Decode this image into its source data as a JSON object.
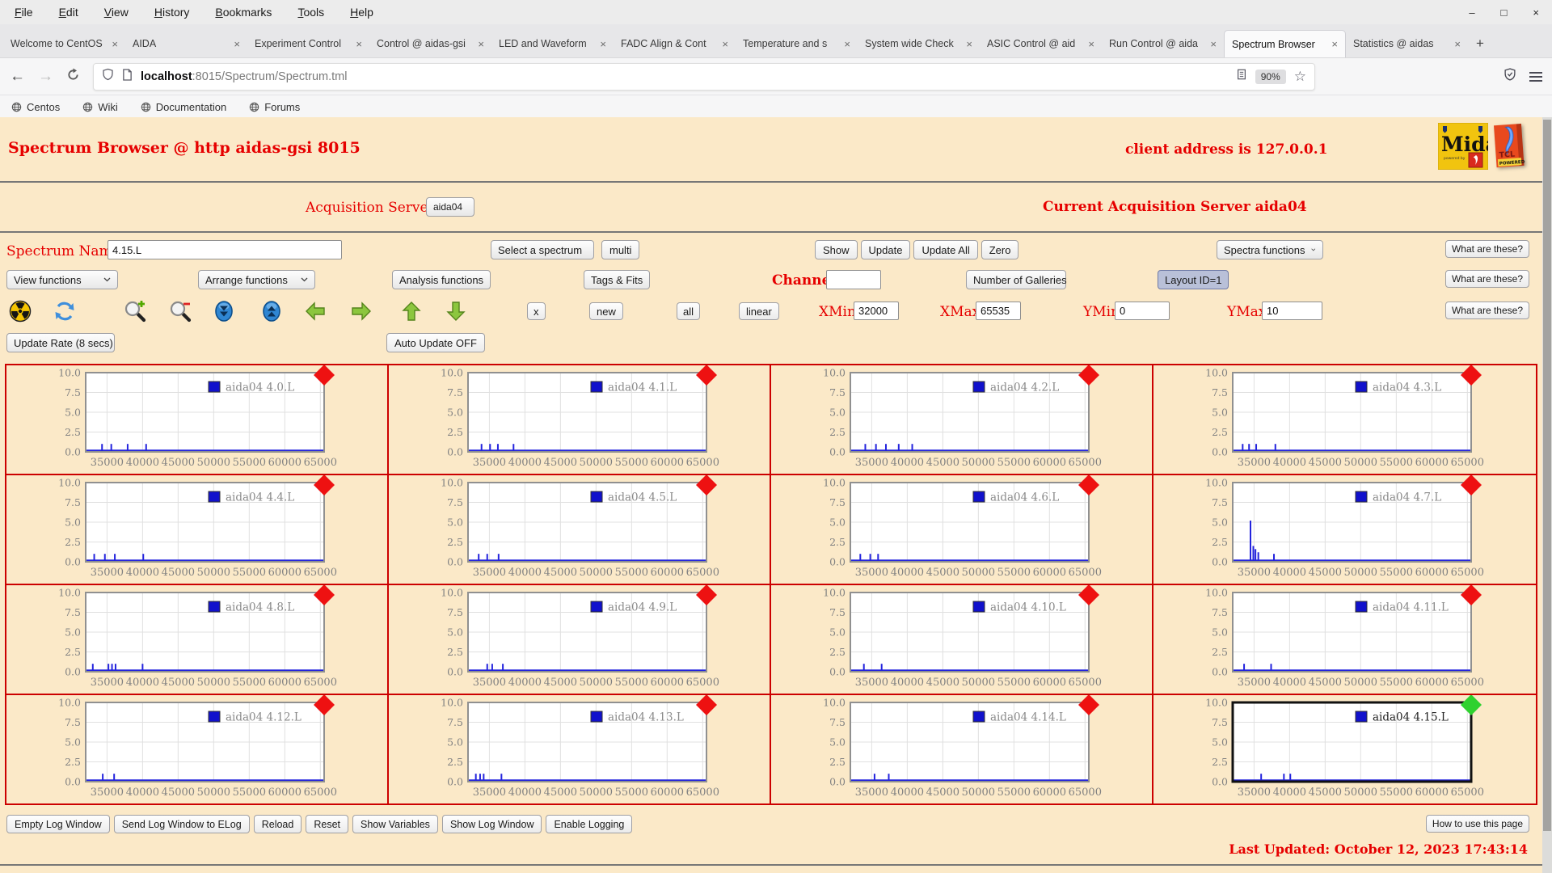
{
  "browser": {
    "menu_items": [
      "File",
      "Edit",
      "View",
      "History",
      "Bookmarks",
      "Tools",
      "Help"
    ],
    "window_controls": {
      "minimize": "–",
      "maximize": "□",
      "close": "×"
    },
    "tab_close_glyph": "×",
    "new_tab_label": "+",
    "tabs": [
      {
        "title": "Welcome to CentOS",
        "active": false
      },
      {
        "title": "AIDA",
        "active": false
      },
      {
        "title": "Experiment Control",
        "active": false
      },
      {
        "title": "Control @ aidas-gsi",
        "active": false
      },
      {
        "title": "LED and Waveform",
        "active": false
      },
      {
        "title": "FADC Align & Cont",
        "active": false
      },
      {
        "title": "Temperature and s",
        "active": false
      },
      {
        "title": "System wide Check",
        "active": false
      },
      {
        "title": "ASIC Control @ aid",
        "active": false
      },
      {
        "title": "Run Control @ aida",
        "active": false
      },
      {
        "title": "Spectrum Browser",
        "active": true
      },
      {
        "title": "Statistics @ aidas",
        "active": false
      }
    ],
    "url_host": "localhost",
    "url_path": ":8015/Spectrum/Spectrum.tml",
    "zoom_level": "90%",
    "bookmarks": [
      "Centos",
      "Wiki",
      "Documentation",
      "Forums"
    ]
  },
  "page": {
    "title": "Spectrum Browser @ http aidas-gsi 8015",
    "client_address": "client address is 127.0.0.1",
    "acquisition_servers_label": "Acquisition Servers",
    "acquisition_server_selected": "aida04",
    "current_server_text": "Current Acquisition Server aida04",
    "spectrum_name_label": "Spectrum Name:",
    "spectrum_name_value": "4.15.L",
    "select_spectrum_label": "Select a spectrum",
    "multi_label": "multi",
    "show_label": "Show",
    "update_label": "Update",
    "update_all_label": "Update All",
    "zero_label": "Zero",
    "spectra_functions_label": "Spectra functions",
    "what_are_these_label": "What are these?",
    "view_functions_label": "View functions",
    "arrange_functions_label": "Arrange functions",
    "analysis_functions_label": "Analysis functions",
    "tags_fits_label": "Tags & Fits",
    "channel_label": "Channel:",
    "channel_value": "",
    "number_of_galleries_label": "Number of Galleries",
    "layout_id_label": "Layout ID=1",
    "x_button_label": "x",
    "new_button_label": "new",
    "all_button_label": "all",
    "linear_button_label": "linear",
    "xmin_label": "XMin",
    "xmin_value": "32000",
    "xmax_label": "XMax",
    "xmax_value": "65535",
    "ymin_label": "YMin",
    "ymin_value": "0",
    "ymax_label": "YMax",
    "ymax_value": "10",
    "update_rate_label": "Update Rate (8 secs)",
    "auto_update_label": "Auto Update OFF",
    "footer_buttons": [
      "Empty Log Window",
      "Send Log Window to ELog",
      "Reload",
      "Reset",
      "Show Variables",
      "Show Log Window",
      "Enable Logging"
    ],
    "how_to_label": "How to use this page",
    "last_updated": "Last Updated: October 12, 2023 17:43:14",
    "logo_midas_text": "Midas",
    "logo_midas_sub": "powered by",
    "logo_tcl_text": "TCL",
    "logo_tcl_sub": "POWERED",
    "toolbar_icon_names": [
      "radiation-icon",
      "refresh-icon",
      "zoom-in-icon",
      "zoom-out-icon",
      "scroll-down-icon",
      "scroll-up-icon",
      "arrow-left-icon",
      "arrow-right-icon",
      "arrow-up-icon",
      "arrow-down-icon"
    ]
  },
  "chart_data": {
    "type": "bar",
    "title": "",
    "xlabel": "",
    "ylabel": "",
    "xlim": [
      32000,
      65535
    ],
    "ylim": [
      0,
      10
    ],
    "x_ticks": [
      35000,
      40000,
      45000,
      50000,
      55000,
      60000,
      65000
    ],
    "y_ticks": [
      0,
      2.5,
      5,
      7.5,
      10
    ],
    "grid": true,
    "legend_position": "top-right",
    "colors": {
      "series": "#2323dd",
      "legend_swatch": "#1111cc",
      "marker": "#ee1111",
      "marker_selected": "#2fd12f",
      "grid": "#e0e0e0",
      "tick_text": "#828282",
      "frame": "#909090",
      "frame_selected": "#111111"
    },
    "spectra": [
      {
        "name": "aida04 4.0.L",
        "selected": false,
        "spikes": [
          [
            34300,
            1
          ],
          [
            35600,
            1
          ],
          [
            37900,
            1
          ],
          [
            40500,
            1
          ]
        ]
      },
      {
        "name": "aida04 4.1.L",
        "selected": false,
        "spikes": [
          [
            33900,
            1
          ],
          [
            35100,
            1
          ],
          [
            36200,
            1
          ],
          [
            38400,
            1
          ]
        ]
      },
      {
        "name": "aida04 4.2.L",
        "selected": false,
        "spikes": [
          [
            34100,
            1
          ],
          [
            35600,
            1
          ],
          [
            37000,
            1
          ],
          [
            38800,
            1
          ],
          [
            40700,
            1
          ]
        ]
      },
      {
        "name": "aida04 4.3.L",
        "selected": false,
        "spikes": [
          [
            33400,
            1
          ],
          [
            34300,
            1
          ],
          [
            35300,
            1
          ],
          [
            38000,
            1
          ]
        ]
      },
      {
        "name": "aida04 4.4.L",
        "selected": false,
        "spikes": [
          [
            33200,
            1
          ],
          [
            34700,
            1
          ],
          [
            36100,
            1
          ],
          [
            40100,
            1
          ]
        ]
      },
      {
        "name": "aida04 4.5.L",
        "selected": false,
        "spikes": [
          [
            33500,
            1
          ],
          [
            34700,
            1
          ],
          [
            36300,
            1
          ]
        ]
      },
      {
        "name": "aida04 4.6.L",
        "selected": false,
        "spikes": [
          [
            33400,
            1
          ],
          [
            34800,
            1
          ],
          [
            35900,
            1
          ]
        ]
      },
      {
        "name": "aida04 4.7.L",
        "selected": false,
        "spikes": [
          [
            34500,
            5.2
          ],
          [
            34900,
            2
          ],
          [
            35200,
            1.6
          ],
          [
            35600,
            1.2
          ],
          [
            37800,
            1
          ]
        ]
      },
      {
        "name": "aida04 4.8.L",
        "selected": false,
        "spikes": [
          [
            33000,
            1
          ],
          [
            35200,
            1
          ],
          [
            35700,
            1
          ],
          [
            36200,
            1
          ],
          [
            40000,
            1
          ]
        ]
      },
      {
        "name": "aida04 4.9.L",
        "selected": false,
        "spikes": [
          [
            34700,
            1
          ],
          [
            35400,
            1
          ],
          [
            36900,
            1
          ]
        ]
      },
      {
        "name": "aida04 4.10.L",
        "selected": false,
        "spikes": [
          [
            33900,
            1
          ],
          [
            36400,
            1
          ]
        ]
      },
      {
        "name": "aida04 4.11.L",
        "selected": false,
        "spikes": [
          [
            33600,
            1
          ],
          [
            37400,
            1
          ]
        ]
      },
      {
        "name": "aida04 4.12.L",
        "selected": false,
        "spikes": [
          [
            34400,
            1
          ],
          [
            36000,
            1
          ]
        ]
      },
      {
        "name": "aida04 4.13.L",
        "selected": false,
        "spikes": [
          [
            33100,
            1
          ],
          [
            33700,
            1
          ],
          [
            34200,
            1
          ],
          [
            36700,
            1
          ]
        ]
      },
      {
        "name": "aida04 4.14.L",
        "selected": false,
        "spikes": [
          [
            35400,
            1
          ],
          [
            37400,
            1
          ]
        ]
      },
      {
        "name": "aida04 4.15.L",
        "selected": true,
        "spikes": [
          [
            36000,
            1
          ],
          [
            39200,
            1
          ],
          [
            40100,
            1
          ]
        ]
      }
    ]
  }
}
